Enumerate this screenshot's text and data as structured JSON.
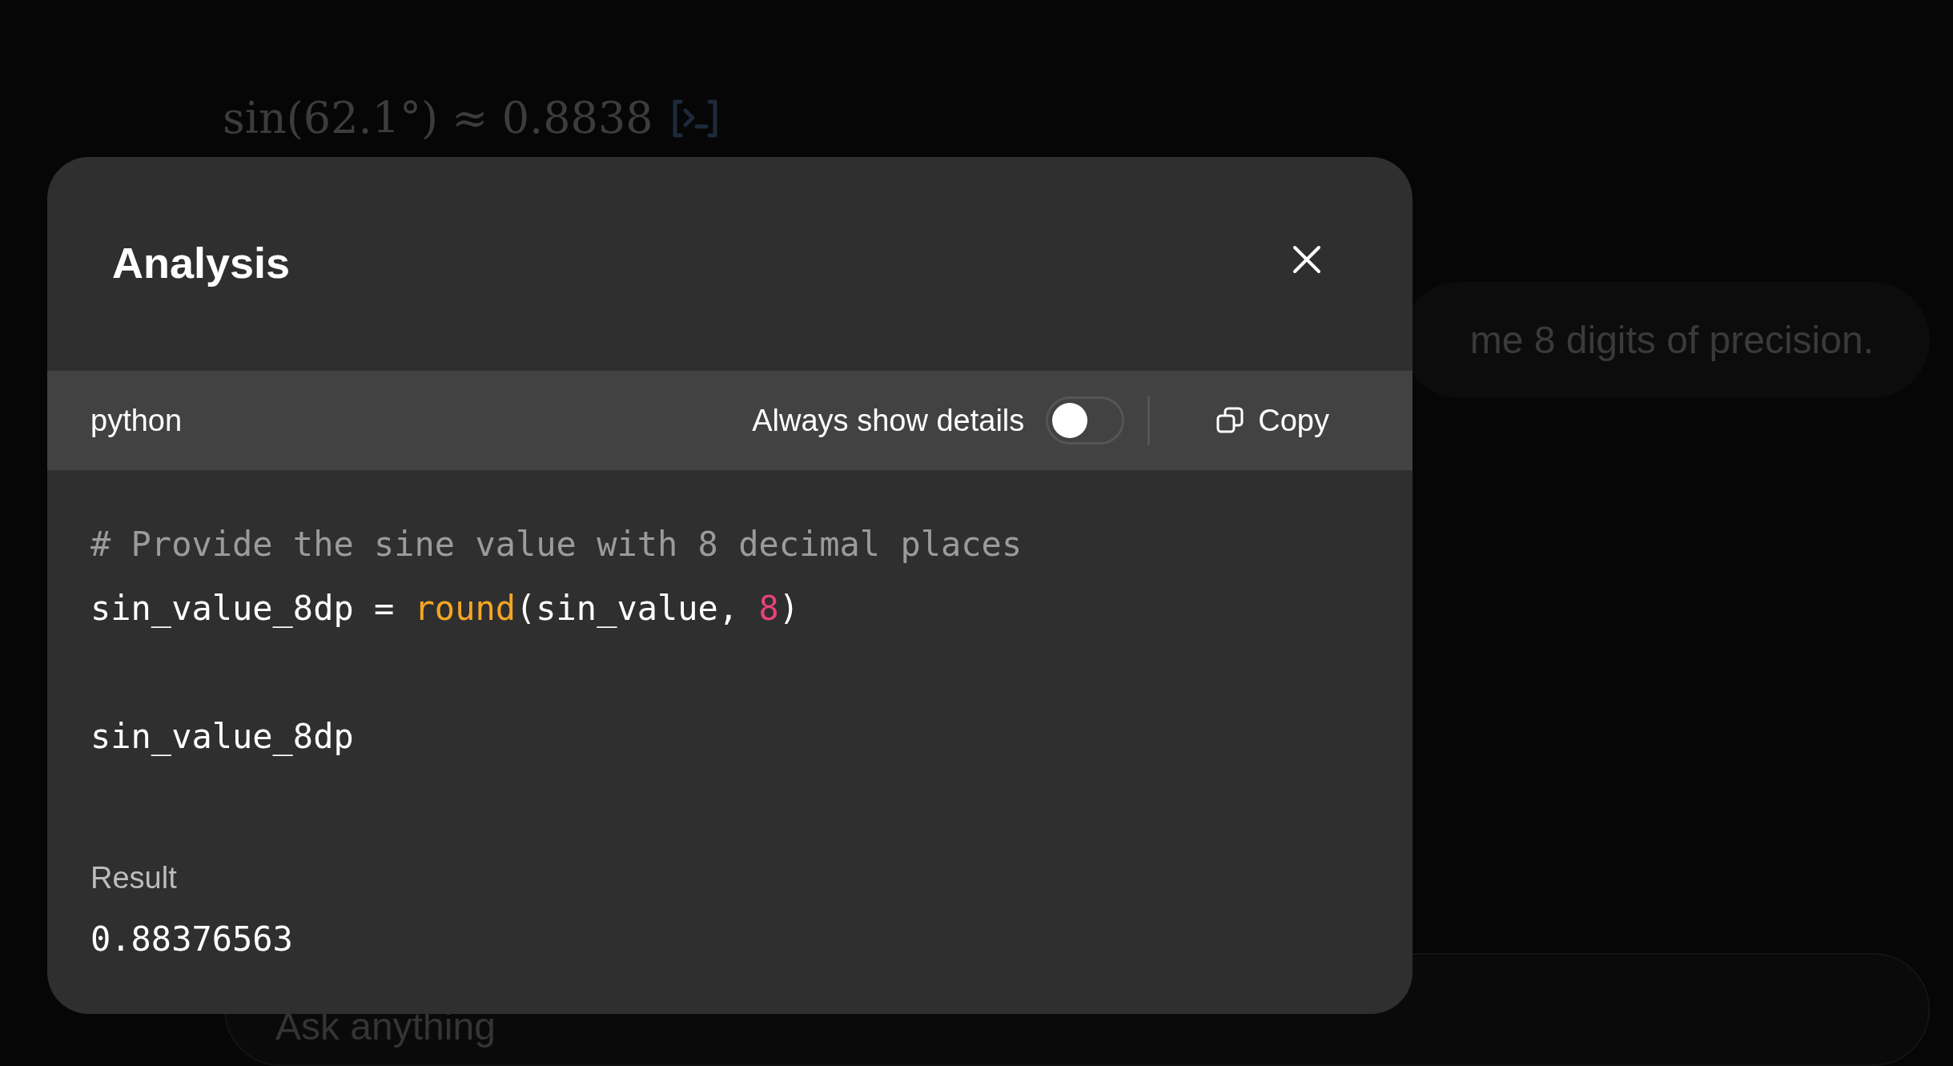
{
  "conversation": {
    "math_line": "sin(62.1°) ≈ 0.8838",
    "user_message": "me 8 digits of precision.",
    "composer": {
      "placeholder": "Ask anything"
    }
  },
  "modal": {
    "title": "Analysis",
    "code_header": {
      "language": "python",
      "toggle_label": "Always show details",
      "toggle_on": false,
      "copy_label": "Copy"
    },
    "code_lines": [
      {
        "spaced": false,
        "tokens": [
          {
            "kind": "comment",
            "text": "# Provide the sine value with 8 decimal places"
          }
        ]
      },
      {
        "spaced": false,
        "tokens": [
          {
            "kind": "plain",
            "text": "sin_value_8dp = "
          },
          {
            "kind": "builtin",
            "text": "round"
          },
          {
            "kind": "plain",
            "text": "(sin_value, "
          },
          {
            "kind": "number",
            "text": "8"
          },
          {
            "kind": "plain",
            "text": ")"
          }
        ]
      },
      {
        "spaced": true,
        "tokens": [
          {
            "kind": "plain",
            "text": "sin_value_8dp"
          }
        ]
      }
    ],
    "result_label": "Result",
    "result_value": "0.88376563"
  }
}
